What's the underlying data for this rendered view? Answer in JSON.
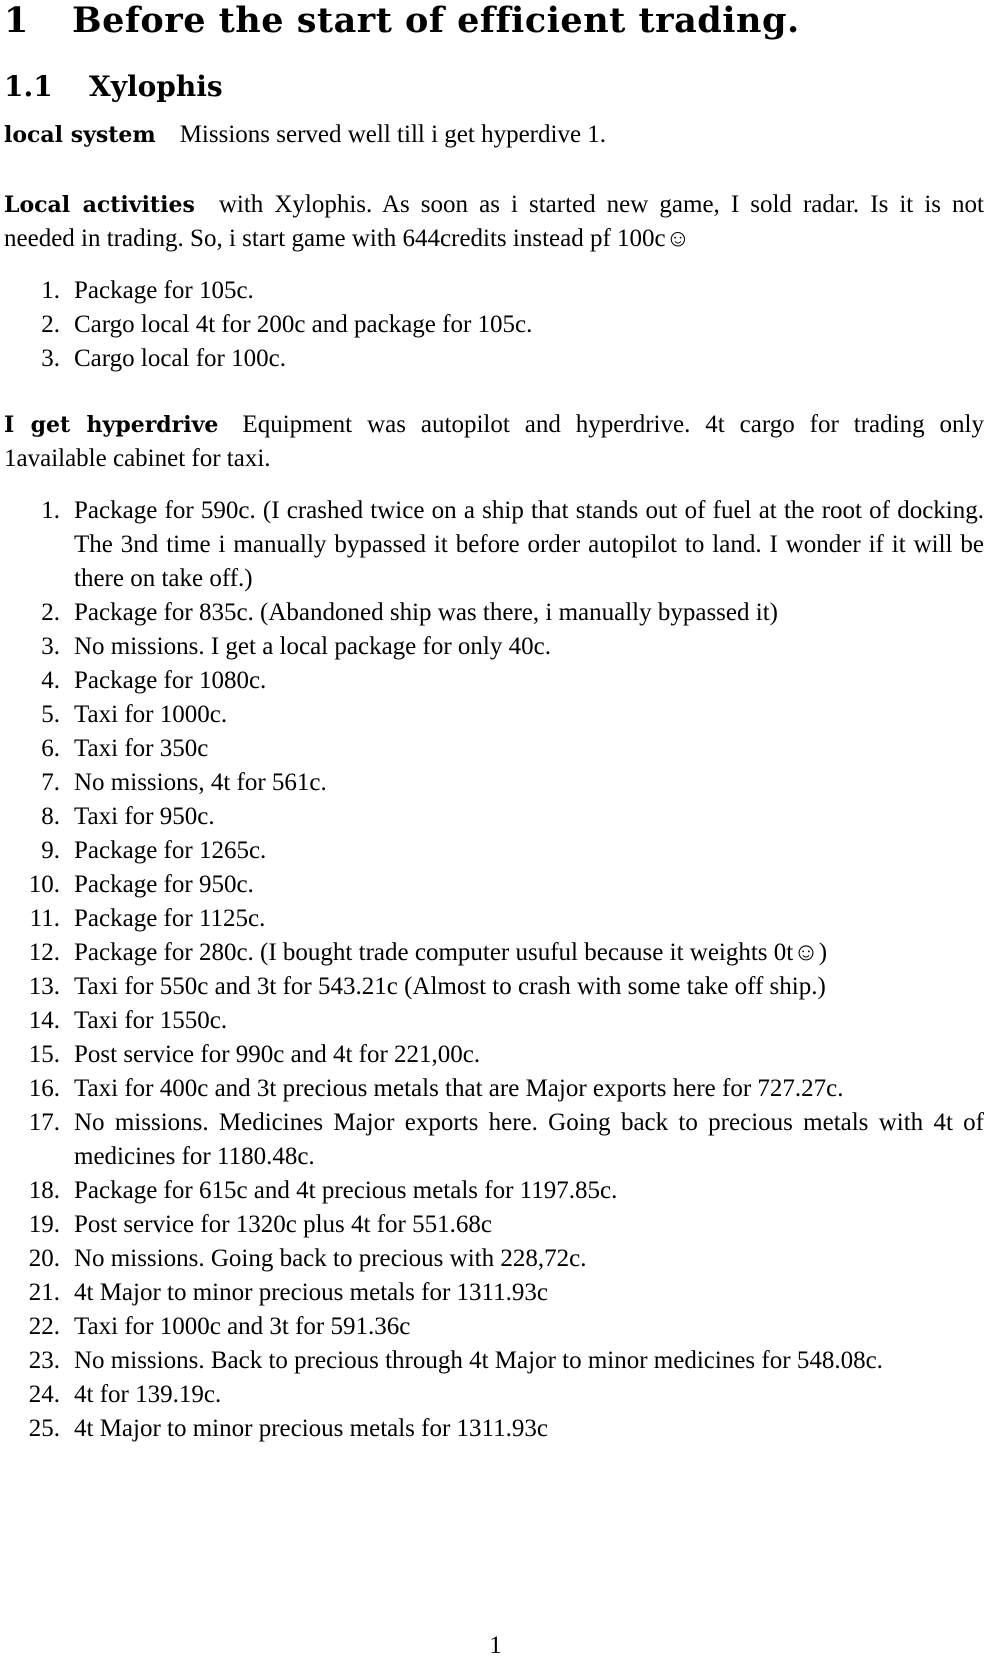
{
  "section": {
    "number": "1",
    "title": "Before the start of efficient trading."
  },
  "subsection": {
    "number": "1.1",
    "title": "Xylophis"
  },
  "para1": {
    "heading": "local system",
    "text": "Missions served well till i get hyperdive 1."
  },
  "para2": {
    "heading": "Local activities",
    "text": "with Xylophis. As soon as i started new game, I sold radar. Is it is not needed in trading. So, i start game with 644credits instead pf 100c",
    "emoji": "☺"
  },
  "list1": [
    {
      "n": "1.",
      "text": "Package for 105c."
    },
    {
      "n": "2.",
      "text": "Cargo local 4t for 200c and package for 105c."
    },
    {
      "n": "3.",
      "text": "Cargo local for 100c."
    }
  ],
  "para3": {
    "heading": "I get hyperdrive",
    "text": "Equipment was autopilot and hyperdrive. 4t cargo for trading only 1available cabinet for taxi."
  },
  "list2": [
    {
      "n": "1.",
      "text": "Package for 590c. (I crashed twice on a ship that stands out of fuel at the root of docking. The 3nd time i manually bypassed it before order autopilot to land. I wonder if it will be there on take off.)"
    },
    {
      "n": "2.",
      "text": "Package for 835c. (Abandoned ship was there, i manually bypassed it)"
    },
    {
      "n": "3.",
      "text": "No missions. I get a local package for only 40c."
    },
    {
      "n": "4.",
      "text": "Package for 1080c."
    },
    {
      "n": "5.",
      "text": "Taxi for 1000c."
    },
    {
      "n": "6.",
      "text": "Taxi for 350c"
    },
    {
      "n": "7.",
      "text": "No missions, 4t for 561c."
    },
    {
      "n": "8.",
      "text": "Taxi for 950c."
    },
    {
      "n": "9.",
      "text": "Package for 1265c."
    },
    {
      "n": "10.",
      "text": "Package for 950c."
    },
    {
      "n": "11.",
      "text": "Package for 1125c."
    },
    {
      "n": "12.",
      "text": "Package for 280c. (I bought trade computer usuful because it weights 0t☺)"
    },
    {
      "n": "13.",
      "text": "Taxi for 550c and 3t for 543.21c (Almost to crash with some take off ship.)"
    },
    {
      "n": "14.",
      "text": "Taxi for 1550c."
    },
    {
      "n": "15.",
      "text": "Post service for 990c and 4t for 221,00c."
    },
    {
      "n": "16.",
      "text": "Taxi for 400c and 3t precious metals that are Major exports here for 727.27c."
    },
    {
      "n": "17.",
      "text": "No missions. Medicines Major exports here. Going back to precious metals with 4t of medicines for 1180.48c."
    },
    {
      "n": "18.",
      "text": "Package for 615c and 4t precious metals for 1197.85c."
    },
    {
      "n": "19.",
      "text": "Post service for 1320c plus 4t for 551.68c"
    },
    {
      "n": "20.",
      "text": "No missions. Going back to precious with 228,72c."
    },
    {
      "n": "21.",
      "text": "4t Major to minor precious metals for 1311.93c"
    },
    {
      "n": "22.",
      "text": "Taxi for 1000c and 3t for 591.36c"
    },
    {
      "n": "23.",
      "text": "No missions. Back to precious through 4t Major to minor medicines for 548.08c."
    },
    {
      "n": "24.",
      "text": "4t for 139.19c."
    },
    {
      "n": "25.",
      "text": "4t Major to minor precious metals for 1311.93c"
    }
  ],
  "page_number": "1"
}
